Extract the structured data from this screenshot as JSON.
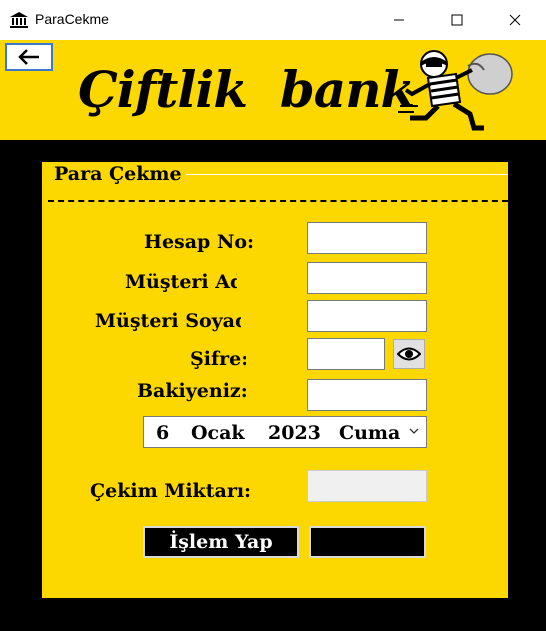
{
  "window": {
    "title": "ParaCekme",
    "icon": "bank-icon",
    "controls": [
      "minimize-icon",
      "maximize-icon",
      "close-icon"
    ]
  },
  "header": {
    "back_icon": "arrow-left-icon",
    "brand": "Çiftlik  bank",
    "mascot": "thief-with-money-bag-icon",
    "background": "#fdd800"
  },
  "panel": {
    "title": "Para Çekme",
    "labels": {
      "account_no": "Hesap No:",
      "first_name": "Müşteri Ad",
      "last_name": "Müşteri Soyad",
      "password": "Şifre:",
      "balance": "Bakiyeniz:",
      "withdraw_amount": "Çekim Miktarı:"
    },
    "fields": {
      "account_no": "",
      "first_name": "",
      "last_name": "",
      "password": "",
      "balance": "",
      "withdraw_amount": ""
    },
    "show_password_icon": "eye-icon",
    "date": {
      "day": "6",
      "month": "Ocak",
      "year": "2023",
      "weekday": "Cuma"
    },
    "buttons": {
      "process": "İşlem Yap",
      "second": ""
    }
  },
  "colors": {
    "accent": "#fdd800",
    "background": "#000000",
    "button": "#000000"
  }
}
